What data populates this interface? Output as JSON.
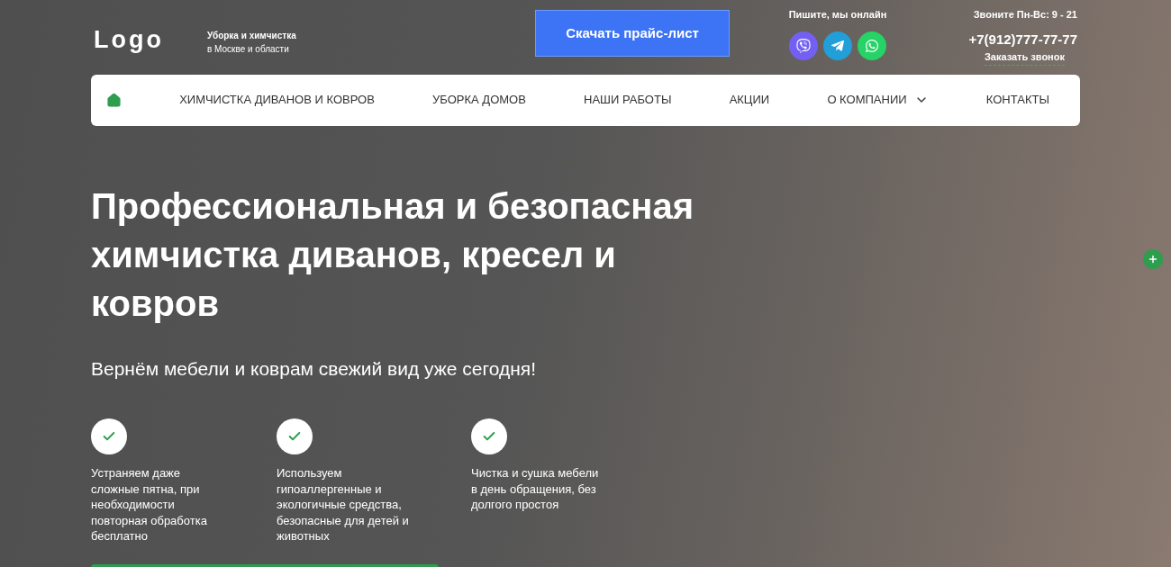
{
  "header": {
    "logo": "Logo",
    "tagline": [
      "Уборка и химчистка",
      "в Москве и области"
    ],
    "price_button": "Скачать прайс-лист",
    "online": "Пишите, мы онлайн",
    "messengers": [
      {
        "kind": "viber",
        "color": "#7360f2"
      },
      {
        "kind": "telegram",
        "color": "#229ed9"
      },
      {
        "kind": "whatsapp",
        "color": "#25d366"
      }
    ],
    "hours": "Звоните Пн-Вс: 9 - 21",
    "phone": "+7(912)777-77-77",
    "callback": "Заказать звонок"
  },
  "nav": {
    "items": [
      {
        "label": "ХИМЧИСТКА ДИВАНОВ И КОВРОВ",
        "dropdown": false
      },
      {
        "label": "УБОРКА ДОМОВ",
        "dropdown": false
      },
      {
        "label": "НАШИ РАБОТЫ",
        "dropdown": false
      },
      {
        "label": "АКЦИИ",
        "dropdown": false
      },
      {
        "label": "О КОМПАНИИ",
        "dropdown": true
      },
      {
        "label": "КОНТАКТЫ",
        "dropdown": false
      }
    ]
  },
  "hero": {
    "title": "Профессиональная и безопасная химчистка диванов, кресел и ковров",
    "subtitle": "Вернём мебели и коврам свежий вид уже сегодня!",
    "features": [
      "Устраняем даже сложные пятна, при необходимости повторная обработка бесплатно",
      "Используем гипоаллергенные и экологичные средства, безопасные для детей и животных",
      "Чистка и сушка мебели в день обращения, без долгого простоя"
    ]
  }
}
